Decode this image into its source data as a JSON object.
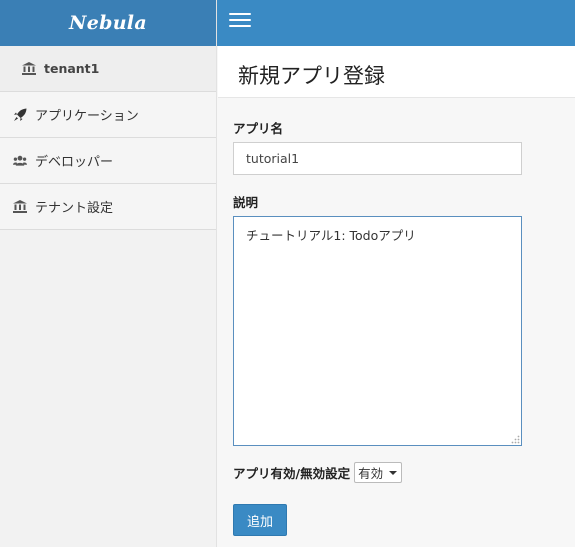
{
  "brand": {
    "name": "Nebula"
  },
  "sidebar": {
    "tenant": {
      "label": "tenant1",
      "icon": "bank-icon"
    },
    "items": [
      {
        "label": "アプリケーション",
        "icon": "rocket-icon"
      },
      {
        "label": "デベロッパー",
        "icon": "users-icon"
      },
      {
        "label": "テナント設定",
        "icon": "bank-icon"
      }
    ]
  },
  "header": {
    "title": "新規アプリ登録"
  },
  "form": {
    "app_name_label": "アプリ名",
    "app_name_value": "tutorial1",
    "description_label": "説明",
    "description_value": "チュートリアル1: Todoアプリ",
    "status_label": "アプリ有効/無効設定",
    "status_selected": "有効",
    "submit_label": "追加"
  },
  "colors": {
    "brand_bar": "#3a7fb5",
    "topbar": "#3a8ac4",
    "button": "#3a8ac4"
  }
}
